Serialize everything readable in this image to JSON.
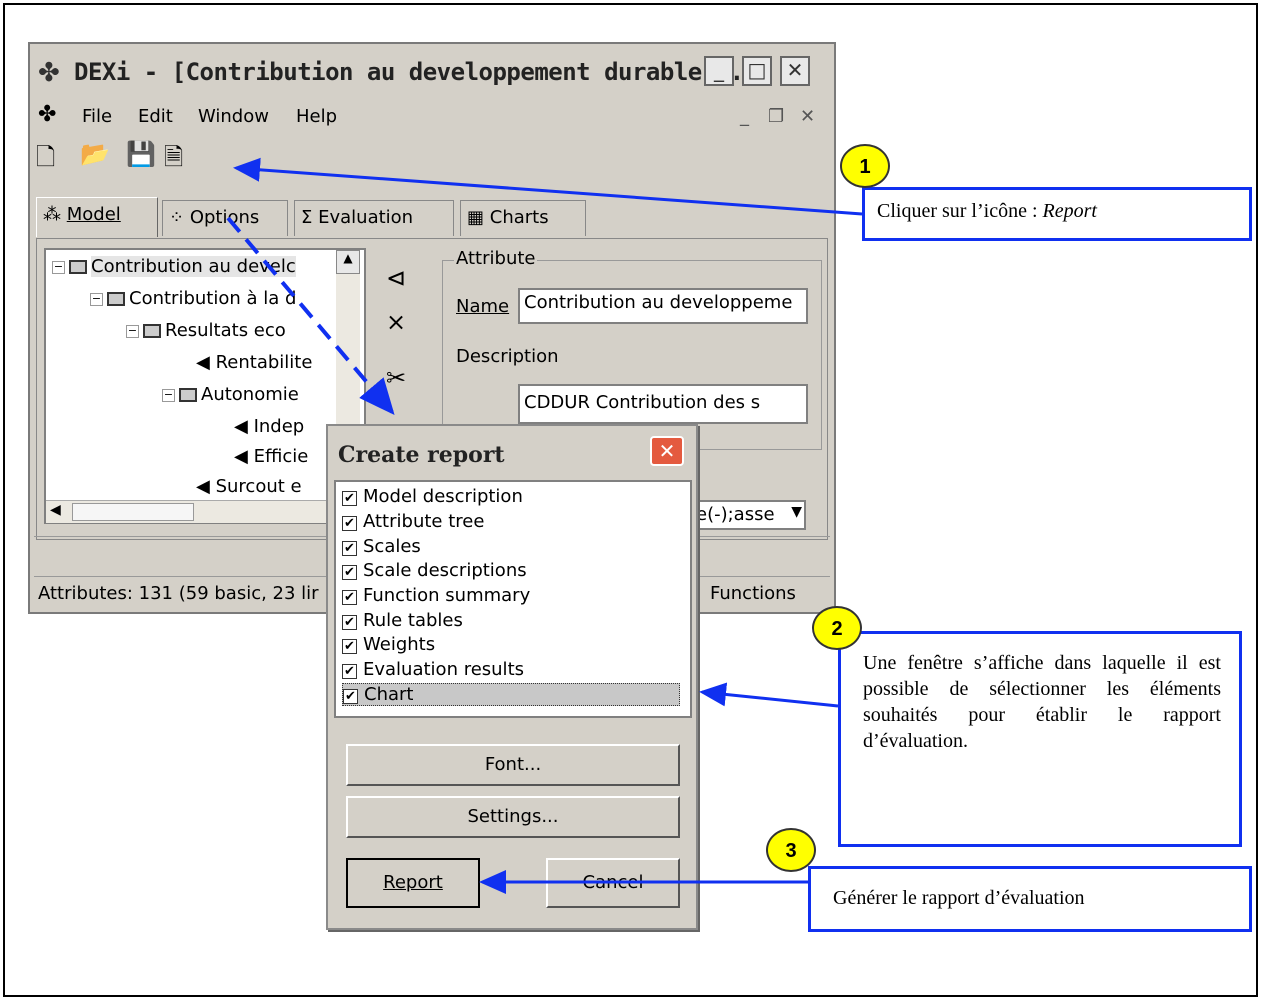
{
  "app": {
    "title": "DEXi - [Contribution au developpement durable ...",
    "menu": [
      "File",
      "Edit",
      "Window",
      "Help"
    ],
    "tabs": [
      "Model",
      "Options",
      "Evaluation",
      "Charts"
    ],
    "tree": [
      "Contribution au develc",
      "Contribution à la d",
      "Resultats eco",
      "Rentabilite",
      "Autonomie",
      "Indep",
      "Efficie",
      "Surcout e"
    ],
    "attribute_group": "Attribute",
    "name_label": "Name",
    "name_value": "Contribution au developpeme",
    "description_label": "Description",
    "description_value": "CDDUR    Contribution des s",
    "dropdown_value": "e(-);asse",
    "status_left": "Attributes: 131 (59 basic, 23 lir",
    "status_right": "Functions"
  },
  "dialog": {
    "title": "Create report",
    "items": [
      {
        "label": "Model description",
        "checked": true
      },
      {
        "label": "Attribute tree",
        "checked": true
      },
      {
        "label": "Scales",
        "checked": true
      },
      {
        "label": "Scale descriptions",
        "checked": true
      },
      {
        "label": "Function summary",
        "checked": true
      },
      {
        "label": "Rule tables",
        "checked": true
      },
      {
        "label": "Weights",
        "checked": true
      },
      {
        "label": "Evaluation results",
        "checked": true
      },
      {
        "label": "Chart",
        "checked": true
      }
    ],
    "font_button": "Font...",
    "settings_button": "Settings...",
    "report_button": "Report",
    "cancel_button": "Cancel"
  },
  "annotations": {
    "step1_number": "1",
    "step1_text": "Cliquer sur l’icône : ",
    "step1_emph": "Report",
    "step2_number": "2",
    "step2_text": "Une fenêtre s’affiche dans laquelle il est possible de sélectionner les éléments souhaités pour établir le rapport d’évaluation.",
    "step3_number": "3",
    "step3_text": "Générer le rapport d’évaluation",
    "arrow_color": "#1030f0",
    "circle_color": "#ffff00"
  }
}
